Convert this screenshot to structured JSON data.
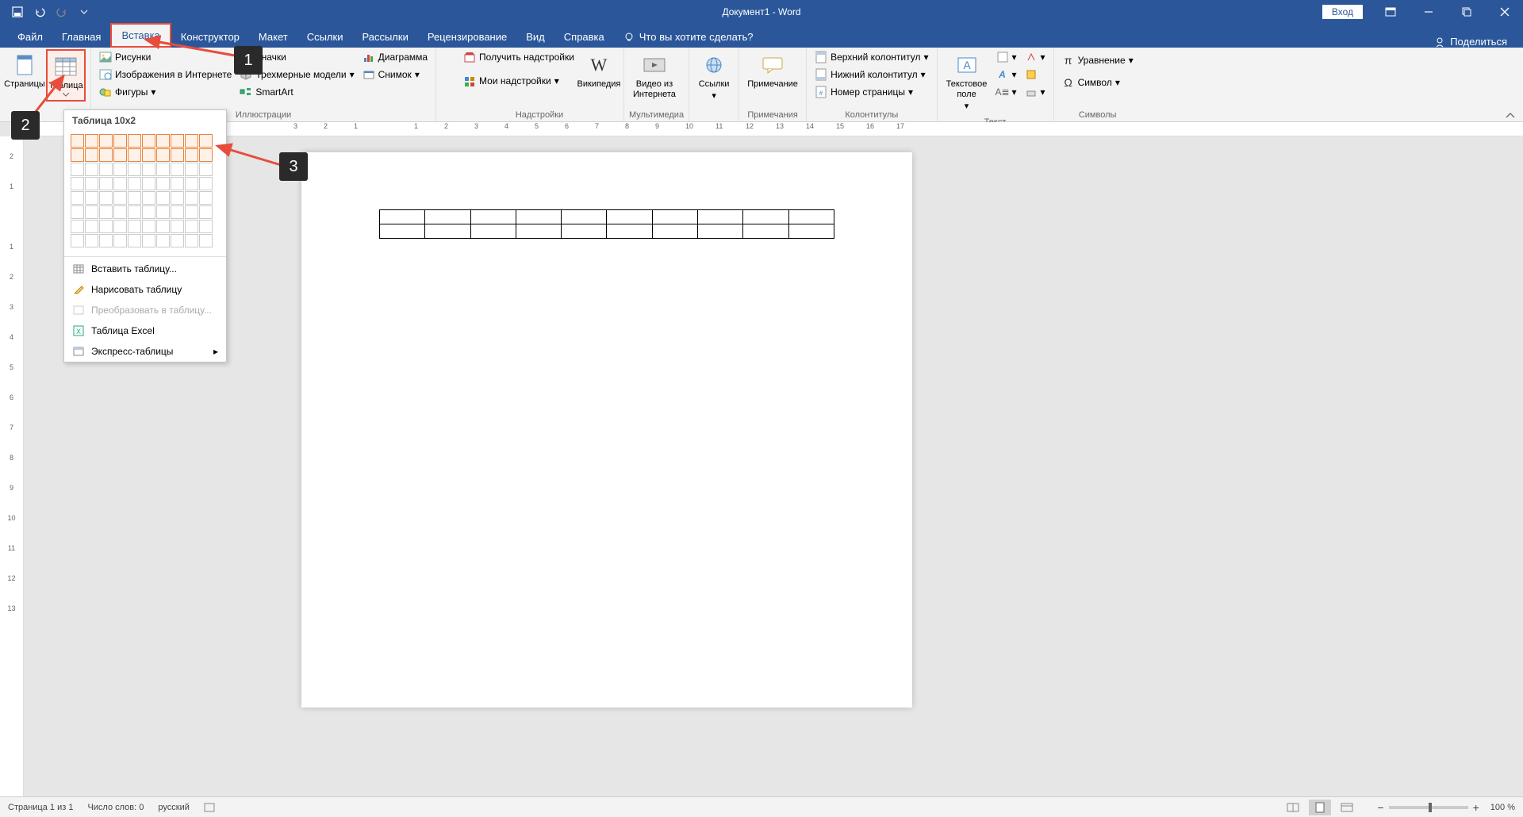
{
  "title": "Документ1  -  Word",
  "login_btn": "Вход",
  "tabs": {
    "file": "Файл",
    "home": "Главная",
    "insert": "Вставка",
    "design": "Конструктор",
    "layout": "Макет",
    "references": "Ссылки",
    "mailings": "Рассылки",
    "review": "Рецензирование",
    "view": "Вид",
    "help": "Справка",
    "tellme": "Что вы хотите сделать?",
    "share": "Поделиться"
  },
  "ribbon": {
    "pages": {
      "label_group": "",
      "pages_btn": "Страницы",
      "table_btn": "Таблица"
    },
    "illustrations": {
      "group": "Иллюстрации",
      "pictures": "Рисунки",
      "online_pictures": "Изображения в Интернете",
      "shapes": "Фигуры",
      "icons": "Значки",
      "models3d": "Трехмерные модели",
      "smartart": "SmartArt",
      "chart": "Диаграмма",
      "screenshot": "Снимок"
    },
    "addins": {
      "group": "Надстройки",
      "get": "Получить надстройки",
      "my": "Мои надстройки",
      "wiki": "Википедия"
    },
    "media": {
      "group": "Мультимедиа",
      "video": "Видео из Интернета"
    },
    "links": {
      "group": "",
      "links_btn": "Ссылки"
    },
    "comments": {
      "group": "Примечания",
      "comment": "Примечание"
    },
    "headerfooter": {
      "group": "Колонтитулы",
      "header": "Верхний колонтитул",
      "footer": "Нижний колонтитул",
      "pagenum": "Номер страницы"
    },
    "text": {
      "group": "Текст",
      "textbox": "Текстовое поле"
    },
    "symbols": {
      "group": "Символы",
      "equation": "Уравнение",
      "symbol": "Символ"
    }
  },
  "dropdown": {
    "title": "Таблица 10x2",
    "insert": "Вставить таблицу...",
    "draw": "Нарисовать таблицу",
    "convert": "Преобразовать в таблицу...",
    "excel": "Таблица Excel",
    "quick": "Экспресс-таблицы"
  },
  "status": {
    "page": "Страница 1 из 1",
    "words": "Число слов: 0",
    "lang": "русский",
    "zoom": "100 %"
  },
  "annotations": {
    "a1": "1",
    "a2": "2",
    "a3": "3"
  }
}
